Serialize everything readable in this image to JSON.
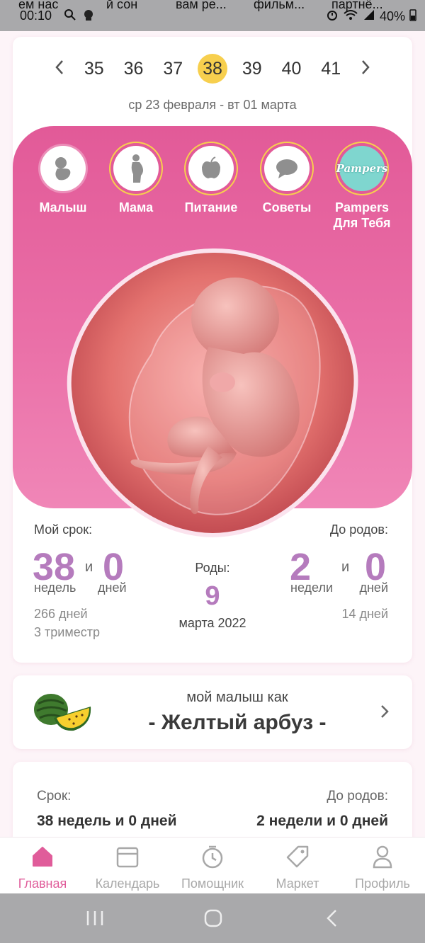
{
  "status_bar": {
    "time": "00:10",
    "notif_1": "ем нас",
    "notif_2": "й сон",
    "notif_3": "вам ре...",
    "notif_4": "фильм...",
    "notif_5": "партнё...",
    "battery": "40%"
  },
  "week_selector": {
    "weeks": [
      "35",
      "36",
      "37",
      "38",
      "39",
      "40",
      "41"
    ],
    "selected": "38",
    "date_range": "ср 23 февраля - вт 01 марта"
  },
  "categories": [
    {
      "label": "Малыш",
      "icon": "baby-icon"
    },
    {
      "label": "Мама",
      "icon": "pregnant-woman-icon"
    },
    {
      "label": "Питание",
      "icon": "apple-icon"
    },
    {
      "label": "Советы",
      "icon": "chat-bubble-icon"
    },
    {
      "label": "Pampers Для Тебя",
      "icon": "pampers-logo-icon"
    }
  ],
  "pampers_logo_text": "Pampers",
  "term": {
    "title": "Мой срок:",
    "weeks": "38",
    "and": "и",
    "days": "0",
    "weeks_unit": "недель",
    "days_unit": "дней",
    "total_days": "266 дней",
    "trimester": "3 триместр"
  },
  "birth": {
    "title": "Роды:",
    "day": "9",
    "month_year": "марта 2022"
  },
  "until": {
    "title": "До родов:",
    "weeks": "2",
    "and": "и",
    "days": "0",
    "weeks_unit": "недели",
    "days_unit": "дней",
    "total_days": "14 дней"
  },
  "fruit_card": {
    "caption": "мой малыш как",
    "fruit": "- Желтый арбуз -",
    "icon": "watermelon-icon"
  },
  "summary": {
    "term_label": "Срок:",
    "term_value": "38 недель и 0 дней",
    "until_label": "До родов:",
    "until_value": "2 недели и 0 дней"
  },
  "bottom_nav": [
    {
      "label": "Главная",
      "icon": "home-icon",
      "active": true
    },
    {
      "label": "Календарь",
      "icon": "calendar-icon",
      "active": false
    },
    {
      "label": "Помощник",
      "icon": "stopwatch-icon",
      "active": false
    },
    {
      "label": "Маркет",
      "icon": "tag-icon",
      "active": false
    },
    {
      "label": "Профиль",
      "icon": "profile-icon",
      "active": false
    }
  ],
  "colors": {
    "accent_pink": "#e25a98",
    "number_purple": "#b57bbd",
    "selected_week": "#f7cf4e",
    "nav_active": "#e05c9a"
  }
}
